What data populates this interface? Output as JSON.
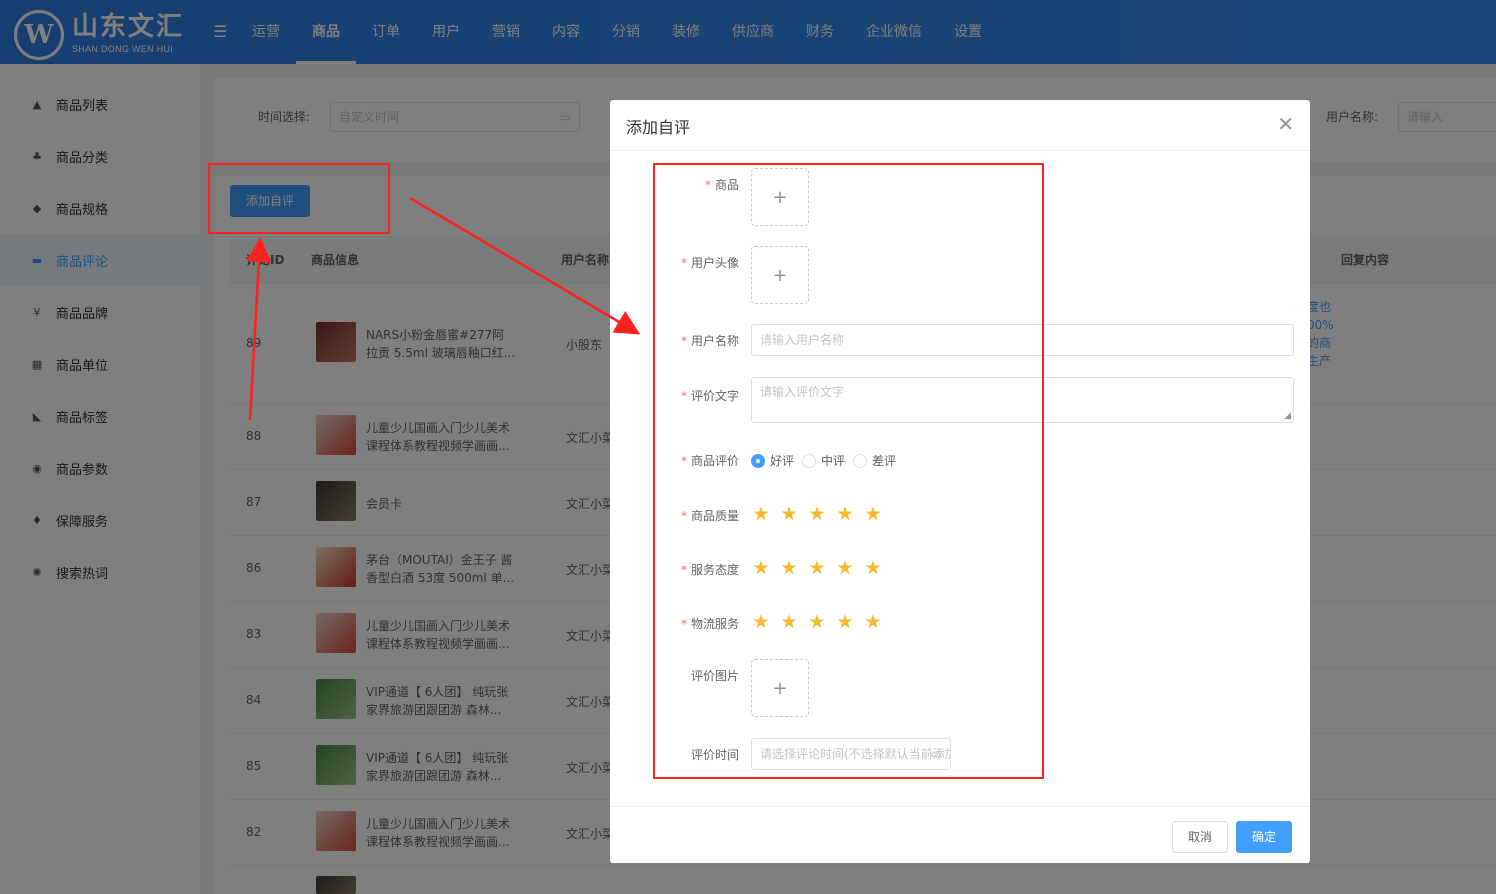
{
  "brand": {
    "logo_letter": "W",
    "name_cn": "山东文汇",
    "name_en": "SHAN DONG WEN HUI"
  },
  "nav": {
    "toggle_icon": "menu-fold-icon",
    "items": [
      {
        "label": "运营"
      },
      {
        "label": "商品"
      },
      {
        "label": "订单"
      },
      {
        "label": "用户"
      },
      {
        "label": "营销"
      },
      {
        "label": "内容"
      },
      {
        "label": "分销"
      },
      {
        "label": "装修"
      },
      {
        "label": "供应商"
      },
      {
        "label": "财务"
      },
      {
        "label": "企业微信"
      },
      {
        "label": "设置"
      }
    ],
    "active": "商品"
  },
  "sidebar": {
    "items": [
      {
        "label": "商品列表",
        "icon": "shop-icon"
      },
      {
        "label": "商品分类",
        "icon": "category-icon"
      },
      {
        "label": "商品规格",
        "icon": "box-icon"
      },
      {
        "label": "商品评论",
        "icon": "comment-icon"
      },
      {
        "label": "商品品牌",
        "icon": "brand-icon"
      },
      {
        "label": "商品单位",
        "icon": "unit-icon"
      },
      {
        "label": "商品标签",
        "icon": "tag-icon"
      },
      {
        "label": "商品参数",
        "icon": "eye-icon"
      },
      {
        "label": "保障服务",
        "icon": "guarantee-icon"
      },
      {
        "label": "搜索热词",
        "icon": "hot-search-icon"
      }
    ],
    "active": "商品评论"
  },
  "filters": {
    "time_label": "时间选择:",
    "time_placeholder": "自定义时间",
    "user_label": "用户名称:",
    "user_placeholder": "请输入"
  },
  "add_button": "添加自评",
  "table": {
    "headers": {
      "id": "评论ID",
      "product": "商品信息",
      "user": "用户名称",
      "reply": "回复内容"
    },
    "rows": [
      {
        "id": "89",
        "product": "NARS小粉金唇蜜#277阿拉贡 5.5ml 玻璃唇釉口红...",
        "user": "小股东"
      },
      {
        "id": "88",
        "product": "儿童少儿国画入门少儿美术课程体系教程视频学画画...",
        "user": "文汇小菜"
      },
      {
        "id": "87",
        "product": "会员卡",
        "user": "文汇小菜"
      },
      {
        "id": "86",
        "product": "茅台（MOUTAI）金王子 酱香型白酒 53度 500ml 单...",
        "user": "文汇小菜"
      },
      {
        "id": "83",
        "product": "儿童少儿国画入门少儿美术课程体系教程视频学画画...",
        "user": "文汇小菜"
      },
      {
        "id": "84",
        "product": "VIP通道【 6人团】 纯玩张家界旅游团跟团游 森林...",
        "user": "文汇小菜"
      },
      {
        "id": "85",
        "product": "VIP通道【 6人团】 纯玩张家界旅游团跟团游 森林...",
        "user": "文汇小菜"
      },
      {
        "id": "82",
        "product": "儿童少儿国画入门少儿美术课程体系教程视频学画画...",
        "user": "文汇小菜"
      }
    ],
    "reply_snippet": [
      "度也",
      "00%",
      "的商",
      "生产"
    ]
  },
  "dialog": {
    "title": "添加自评",
    "close_icon": "close-icon",
    "fields": {
      "product": "商品",
      "avatar": "用户头像",
      "username": "用户名称",
      "username_placeholder": "请输入用户名称",
      "review_text": "评价文字",
      "review_text_placeholder": "请输入评价文字",
      "rating": "商品评价",
      "rating_options": [
        "好评",
        "中评",
        "差评"
      ],
      "rating_selected": "好评",
      "quality": "商品质量",
      "service": "服务态度",
      "logistics": "物流服务",
      "images": "评价图片",
      "time": "评价时间",
      "time_placeholder": "请选择评论时间(不选择默认当前添加时间)"
    },
    "star_scores": {
      "quality": 5,
      "service": 5,
      "logistics": 5
    },
    "upload_symbol": "+",
    "buttons": {
      "cancel": "取消",
      "ok": "确定"
    }
  },
  "colors": {
    "primary": "#409eff",
    "header": "#2f7de3",
    "required": "#f56c6c",
    "star": "#f7ba2a",
    "annotation": "#ff2020"
  }
}
